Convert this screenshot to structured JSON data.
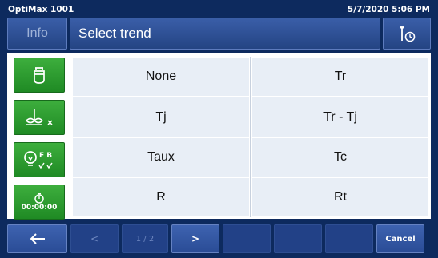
{
  "status": {
    "device": "OptiMax 1001",
    "datetime": "5/7/2020 5:06 PM"
  },
  "header": {
    "info_label": "Info",
    "title": "Select trend",
    "tool_icon": "wrench-timer-icon"
  },
  "sidebar": {
    "buttons": [
      {
        "icon": "reactor-vessel-icon"
      },
      {
        "icon": "stirrer-off-icon"
      },
      {
        "icon": "bulb-fb-icon",
        "text": "F B"
      },
      {
        "icon": "timer-icon",
        "text": "00:00:00"
      }
    ]
  },
  "trends": [
    "None",
    "Tr",
    "Tj",
    "Tr - Tj",
    "Taux",
    "Tc",
    "R",
    "Rt"
  ],
  "footer": {
    "back_icon": "arrow-left-icon",
    "prev_label": "<",
    "page_label": "1 / 2",
    "next_label": ">",
    "cancel_label": "Cancel"
  },
  "colors": {
    "navy": "#0d2a5e",
    "accent_blue": "#2a4c96",
    "green": "#1f8a24",
    "cell": "#e8eef6"
  }
}
